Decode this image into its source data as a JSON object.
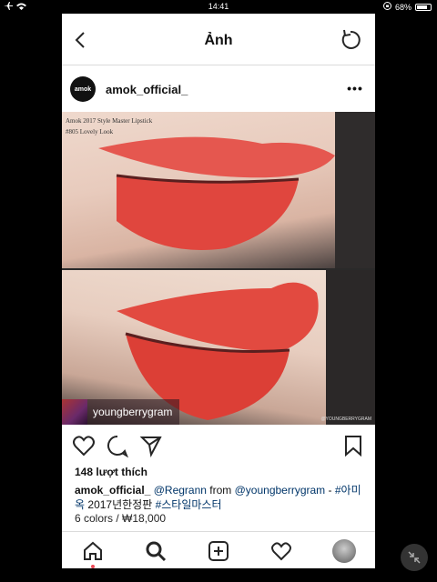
{
  "status_bar": {
    "time": "14:41",
    "battery": "68%",
    "battery_level": 0.68
  },
  "header": {
    "title": "Ảnh"
  },
  "post": {
    "username": "amok_official_",
    "avatar_text": "amok",
    "overlay_line1": "Amok 2017 Style Master Lipstick",
    "overlay_line2": "#805 Lovely Look",
    "repost_user": "youngberrygram",
    "watermark": "@YOUNGBERRYGRAM",
    "likes": "148 lượt thích",
    "caption": {
      "username": "amok_official_",
      "mention1": "@Regrann",
      "from": "from",
      "mention2": "@youngberrygram",
      "dash": "-",
      "tag1": "#아미옥",
      "plain": "2017년한정판",
      "tag2": "#스타일마스터"
    },
    "price_line": "6 colors / ₩18,000"
  },
  "icons": {
    "back": "chevron-left-icon",
    "refresh": "refresh-icon",
    "more": "more-dots-icon",
    "like": "heart-icon",
    "comment": "comment-icon",
    "share": "send-icon",
    "save": "bookmark-icon",
    "home": "home-icon",
    "search": "search-icon",
    "add": "plus-square-icon",
    "activity": "heart-icon",
    "profile": "profile-avatar"
  },
  "colors": {
    "link": "#003569",
    "notification_dot": "#ed4956"
  }
}
